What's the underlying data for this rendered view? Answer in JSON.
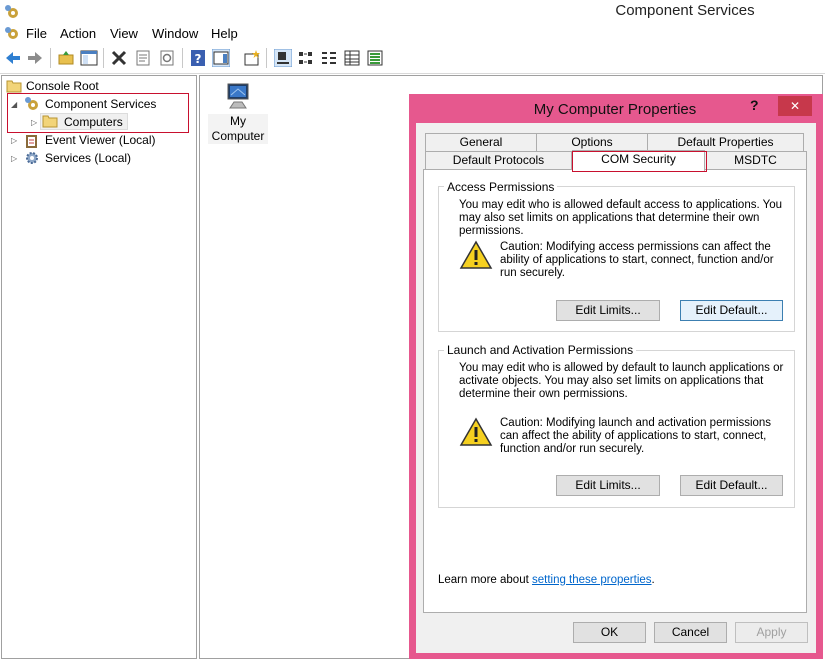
{
  "window": {
    "title": "Component Services"
  },
  "menu": [
    "File",
    "Action",
    "View",
    "Window",
    "Help"
  ],
  "tree": {
    "root": "Console Root",
    "items": [
      {
        "label": "Component Services",
        "expander": "◢"
      },
      {
        "label": "Computers",
        "expander": "▷"
      },
      {
        "label": "Event Viewer (Local)",
        "expander": "▷"
      },
      {
        "label": "Services (Local)",
        "expander": "▷"
      }
    ]
  },
  "content": {
    "item_line1": "My",
    "item_line2": "Computer"
  },
  "dialog": {
    "title": "My Computer Properties",
    "help": "?",
    "close": "✕",
    "tabs_row1": [
      "General",
      "Options",
      "Default Properties"
    ],
    "tabs_row2": [
      "Default Protocols",
      "COM Security",
      "MSDTC"
    ],
    "access": {
      "title": "Access Permissions",
      "desc": "You may edit who is allowed default access to applications. You may also set limits on applications that determine their own permissions.",
      "caution": "Caution: Modifying access permissions can affect the ability of applications to start, connect, function and/or run securely.",
      "edit_limits": "Edit Limits...",
      "edit_default": "Edit Default..."
    },
    "launch": {
      "title": "Launch and Activation Permissions",
      "desc": "You may edit who is allowed by default to launch applications or activate objects. You may also set limits on applications that determine their own permissions.",
      "caution": "Caution: Modifying launch and activation permissions can affect the ability of applications to start, connect, function and/or run securely.",
      "edit_limits": "Edit Limits...",
      "edit_default": "Edit Default..."
    },
    "learn_prefix": "Learn more about ",
    "learn_link": "setting these properties",
    "learn_suffix": ".",
    "ok": "OK",
    "cancel": "Cancel",
    "apply": "Apply"
  },
  "icons": {
    "toolbar": [
      "back-arrow-icon",
      "forward-arrow-icon",
      "up-folder-icon",
      "show-hide-tree-icon",
      "delete-icon",
      "properties-icon",
      "refresh-icon",
      "help-icon",
      "show-hide-action-pane-icon",
      "new-window-icon",
      "large-icons-view-icon",
      "small-icons-view-icon",
      "list-view-icon",
      "detail-view-icon",
      "status-view-icon"
    ]
  },
  "colors": {
    "dialog_border": "#e6588e",
    "close_button": "#c7384b",
    "highlight": "#c8102e",
    "link": "#0066cc"
  }
}
